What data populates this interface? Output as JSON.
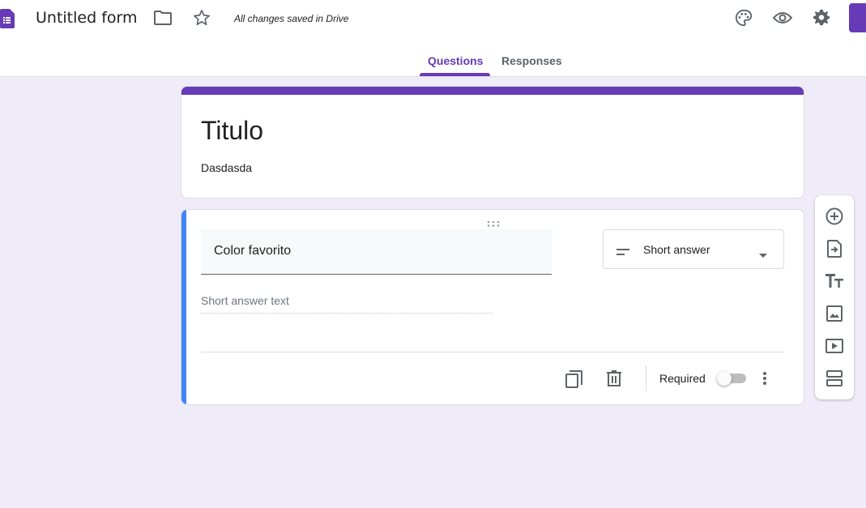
{
  "header": {
    "title": "Untitled form",
    "save_status": "All changes saved in Drive",
    "icons": [
      "forms-app-icon",
      "folder-icon",
      "star-icon",
      "palette-icon",
      "eye-icon",
      "gear-icon"
    ],
    "accent_color": "#673ab7"
  },
  "tabs": [
    {
      "label": "Questions",
      "active": true
    },
    {
      "label": "Responses",
      "active": false
    }
  ],
  "form": {
    "title": "Titulo",
    "description": "Dasdasda"
  },
  "question": {
    "text": "Color favorito",
    "type_label": "Short answer",
    "answer_placeholder": "Short answer text",
    "required_label": "Required",
    "required": false,
    "accent_color": "#4285f4"
  },
  "toolbar": {
    "icons": [
      "add-question-icon",
      "import-questions-icon",
      "add-title-icon",
      "add-image-icon",
      "add-video-icon",
      "add-section-icon"
    ]
  },
  "colors": {
    "background": "#f0ebf8",
    "brand": "#673ab7"
  }
}
